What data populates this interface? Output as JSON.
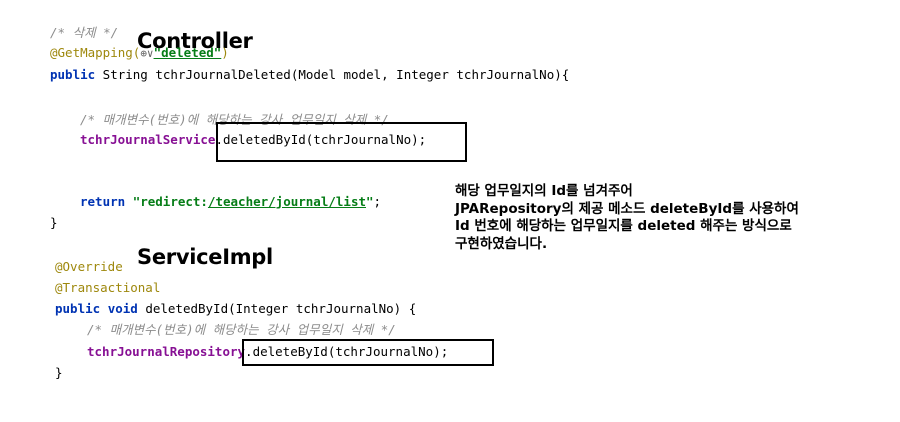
{
  "labels": {
    "controller": "Controller",
    "service_impl": "ServiceImpl"
  },
  "controller": {
    "comment": "/* 삭제 */",
    "mapping_prefix": "@GetMapping(",
    "mapping_icon": "⊕∨",
    "mapping_value": "\"deleted\"",
    "mapping_suffix": ")",
    "sig_public": "public",
    "sig_rest": " String tchrJournalDeleted(Model model, Integer tchrJournalNo){",
    "inner_comment": "/* 매개변수(번호)에 해당하는 강사 업무일지 삭제 */",
    "service_field": "tchrJournalService",
    "service_call": ".deletedById(tchrJournalNo);",
    "return_kw": "return",
    "return_str_open": "\"redirect:",
    "return_str_link": "/teacher/journal/list",
    "return_str_close": "\"",
    "return_end": ";",
    "close_brace": "}"
  },
  "service": {
    "override": "@Override",
    "transactional": "@Transactional",
    "sig_public": "public",
    "sig_void": "void",
    "sig_rest": " deletedById(Integer tchrJournalNo) {",
    "inner_comment": "/* 매개변수(번호)에 해당하는 강사 업무일지 삭제 */",
    "repo_field": "tchrJournalRepository",
    "repo_call": ".deleteById(tchrJournalNo);",
    "close_brace": "}"
  },
  "description": [
    "해당 업무일지의 Id를 넘겨주어",
    "JPARepository의 제공 메소드 deleteById를 사용하여",
    "Id 번호에 해당하는 업무일지를 deleted 해주는 방식으로",
    "구현하였습니다."
  ]
}
